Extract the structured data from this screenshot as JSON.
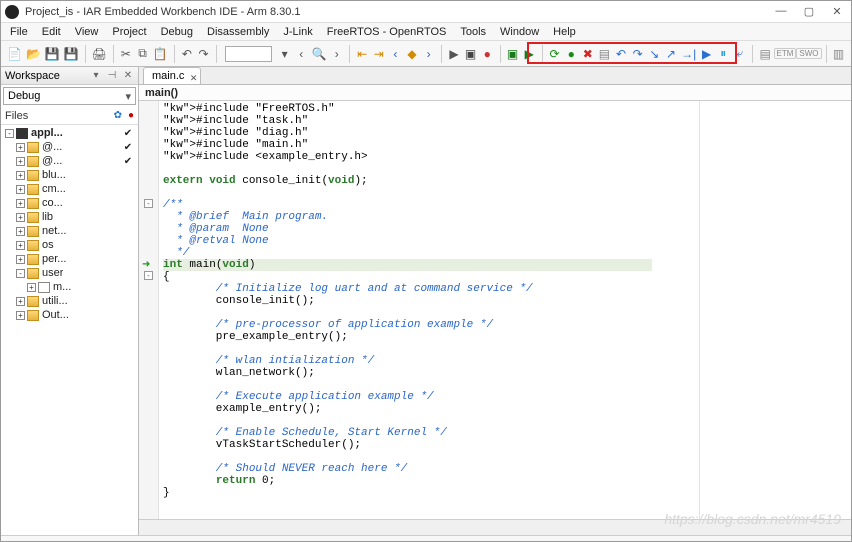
{
  "window": {
    "title": "Project_is - IAR Embedded Workbench IDE - Arm 8.30.1"
  },
  "menu": [
    "File",
    "Edit",
    "View",
    "Project",
    "Debug",
    "Disassembly",
    "J-Link",
    "FreeRTOS - OpenRTOS",
    "Tools",
    "Window",
    "Help"
  ],
  "toolbar_right_labels": {
    "etm": "ETM",
    "swo": "SWO"
  },
  "workspace": {
    "title": "Workspace",
    "config": "Debug",
    "files_header": "Files",
    "tree": [
      {
        "depth": 0,
        "exp": "-",
        "icon": "proj",
        "label": "appl...",
        "bold": true,
        "check": true
      },
      {
        "depth": 1,
        "exp": "+",
        "icon": "folder",
        "label": "@...",
        "check": true
      },
      {
        "depth": 1,
        "exp": "+",
        "icon": "folder",
        "label": "@...",
        "check": true
      },
      {
        "depth": 1,
        "exp": "+",
        "icon": "folder",
        "label": "blu..."
      },
      {
        "depth": 1,
        "exp": "+",
        "icon": "folder",
        "label": "cm..."
      },
      {
        "depth": 1,
        "exp": "+",
        "icon": "folder",
        "label": "co..."
      },
      {
        "depth": 1,
        "exp": "+",
        "icon": "folder",
        "label": "lib"
      },
      {
        "depth": 1,
        "exp": "+",
        "icon": "folder",
        "label": "net..."
      },
      {
        "depth": 1,
        "exp": "+",
        "icon": "folder",
        "label": "os"
      },
      {
        "depth": 1,
        "exp": "+",
        "icon": "folder",
        "label": "per..."
      },
      {
        "depth": 1,
        "exp": "-",
        "icon": "folder",
        "label": "user"
      },
      {
        "depth": 2,
        "exp": "+",
        "icon": "file",
        "label": "m..."
      },
      {
        "depth": 1,
        "exp": "+",
        "icon": "folder",
        "label": "utili..."
      },
      {
        "depth": 1,
        "exp": "+",
        "icon": "folder",
        "label": "Out..."
      }
    ]
  },
  "editor": {
    "tab": "main.c",
    "crumb": "main()",
    "code_lines": [
      {
        "t": "#include \"FreeRTOS.h\"",
        "cls": "inc"
      },
      {
        "t": "#include \"task.h\"",
        "cls": "inc"
      },
      {
        "t": "#include \"diag.h\"",
        "cls": "inc"
      },
      {
        "t": "#include \"main.h\"",
        "cls": "inc"
      },
      {
        "t": "#include <example_entry.h>",
        "cls": "inc"
      },
      {
        "t": ""
      },
      {
        "t": "extern void console_init(void);",
        "cls": "kw"
      },
      {
        "t": ""
      },
      {
        "t": "/**",
        "cls": "cmt",
        "fold": "-"
      },
      {
        "t": "  * @brief  Main program.",
        "cls": "cmt"
      },
      {
        "t": "  * @param  None",
        "cls": "cmt"
      },
      {
        "t": "  * @retval None",
        "cls": "cmt"
      },
      {
        "t": "  */",
        "cls": "cmt"
      },
      {
        "t": "int main(void)",
        "cls": "kw",
        "arrow": true,
        "hl": true
      },
      {
        "t": "{",
        "fold": "-"
      },
      {
        "t": "        /* Initialize log uart and at command service */",
        "cls": "cmt"
      },
      {
        "t": "        console_init();"
      },
      {
        "t": ""
      },
      {
        "t": "        /* pre-processor of application example */",
        "cls": "cmt"
      },
      {
        "t": "        pre_example_entry();"
      },
      {
        "t": ""
      },
      {
        "t": "        /* wlan intialization */",
        "cls": "cmt"
      },
      {
        "t": "        wlan_network();"
      },
      {
        "t": ""
      },
      {
        "t": "        /* Execute application example */",
        "cls": "cmt"
      },
      {
        "t": "        example_entry();"
      },
      {
        "t": ""
      },
      {
        "t": "        /* Enable Schedule, Start Kernel */",
        "cls": "cmt"
      },
      {
        "t": "        vTaskStartScheduler();"
      },
      {
        "t": ""
      },
      {
        "t": "        /* Should NEVER reach here */",
        "cls": "cmt"
      },
      {
        "t": "        return 0;"
      },
      {
        "t": "}"
      }
    ]
  },
  "watermark": "https://blog.csdn.net/mr4519"
}
